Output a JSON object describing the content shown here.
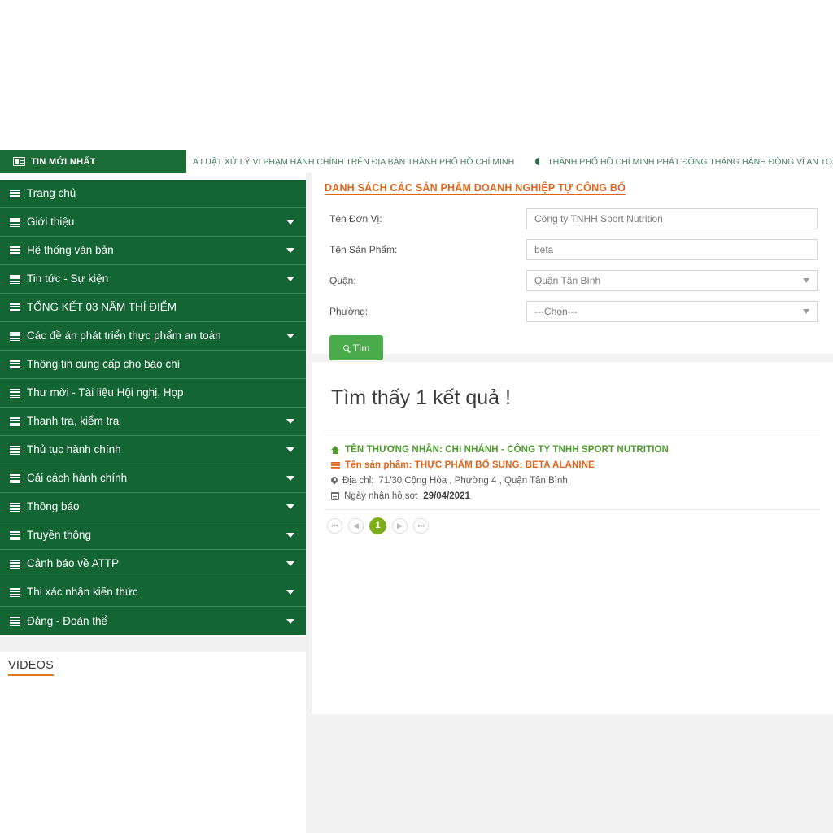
{
  "ticker": {
    "badge_label": "TIN MỚI NHẤT",
    "badge_icon": "newspaper-icon",
    "items": [
      {
        "text": "A LUẬT XỬ LÝ VI PHẠM HÀNH CHÍNH TRÊN ĐỊA BÀN THÀNH PHỐ HỒ CHÍ MINH",
        "has_bullet": false
      },
      {
        "text": "THÀNH PHỐ HỒ CHÍ MINH PHÁT ĐỘNG THÁNG HÀNH ĐỘNG VÌ AN TOÀN THỰC PHẨ",
        "has_bullet": true
      }
    ]
  },
  "sidebar": {
    "items": [
      {
        "label": "Trang chủ",
        "has_caret": false
      },
      {
        "label": "Giới thiệu",
        "has_caret": true
      },
      {
        "label": "Hệ thống văn bản",
        "has_caret": true
      },
      {
        "label": "Tin tức - Sự kiện",
        "has_caret": true
      },
      {
        "label": "TỔNG KẾT 03 NĂM THÍ ĐIỂM",
        "has_caret": false
      },
      {
        "label": "Các đề án phát triển thực phẩm an toàn",
        "has_caret": true
      },
      {
        "label": "Thông tin cung cấp cho báo chí",
        "has_caret": false
      },
      {
        "label": "Thư mời - Tài liệu Hội nghị, Họp",
        "has_caret": false
      },
      {
        "label": "Thanh tra, kiểm tra",
        "has_caret": true
      },
      {
        "label": "Thủ tục hành chính",
        "has_caret": true
      },
      {
        "label": "Cải cách hành chính",
        "has_caret": true
      },
      {
        "label": "Thông báo",
        "has_caret": true
      },
      {
        "label": "Truyền thông",
        "has_caret": true
      },
      {
        "label": "Cảnh báo về ATTP",
        "has_caret": true
      },
      {
        "label": "Thi xác nhận kiến thức",
        "has_caret": true
      },
      {
        "label": "Đảng - Đoàn thể",
        "has_caret": true
      }
    ],
    "videos_title": "VIDEOS"
  },
  "search_panel": {
    "title": "DANH SÁCH CÁC SẢN PHẨM DOANH NGHIỆP TỰ CÔNG BỐ",
    "fields": {
      "unit_label": "Tên Đơn Vị:",
      "unit_value": "Công ty TNHH Sport Nutrition",
      "product_label": "Tên Sản Phẩm:",
      "product_value": "beta",
      "district_label": "Quận:",
      "district_value": "Quận Tân Bình",
      "ward_label": "Phường:",
      "ward_value": "---Chọn---"
    },
    "search_button": "Tìm",
    "search_icon": "magnifier-icon"
  },
  "results": {
    "count_text": "Tìm thấy 1 kết quả !",
    "items": [
      {
        "merchant": "TÊN THƯƠNG NHÂN: CHI NHÁNH - CÔNG TY TNHH SPORT NUTRITION",
        "product": "Tên sản phẩm: THỰC PHẨM BỔ SUNG: BETA ALANINE",
        "address_label": "Địa chỉ:",
        "address_value": "71/30 Cộng Hòa , Phường 4 , Quận Tân Bình",
        "date_label": "Ngày nhận hồ sơ:",
        "date_value": "29/04/2021"
      }
    ],
    "pagination": {
      "first": "⏮",
      "prev": "◀",
      "current": "1",
      "next": "▶",
      "last": "⏭"
    }
  },
  "colors": {
    "sidebar_green": "#136633",
    "badge_green": "#1b6b37",
    "button_green": "#4aab4a",
    "accent_orange": "#e0651c",
    "merchant_green": "#4c9a2a",
    "page_active": "#7fae1b"
  }
}
